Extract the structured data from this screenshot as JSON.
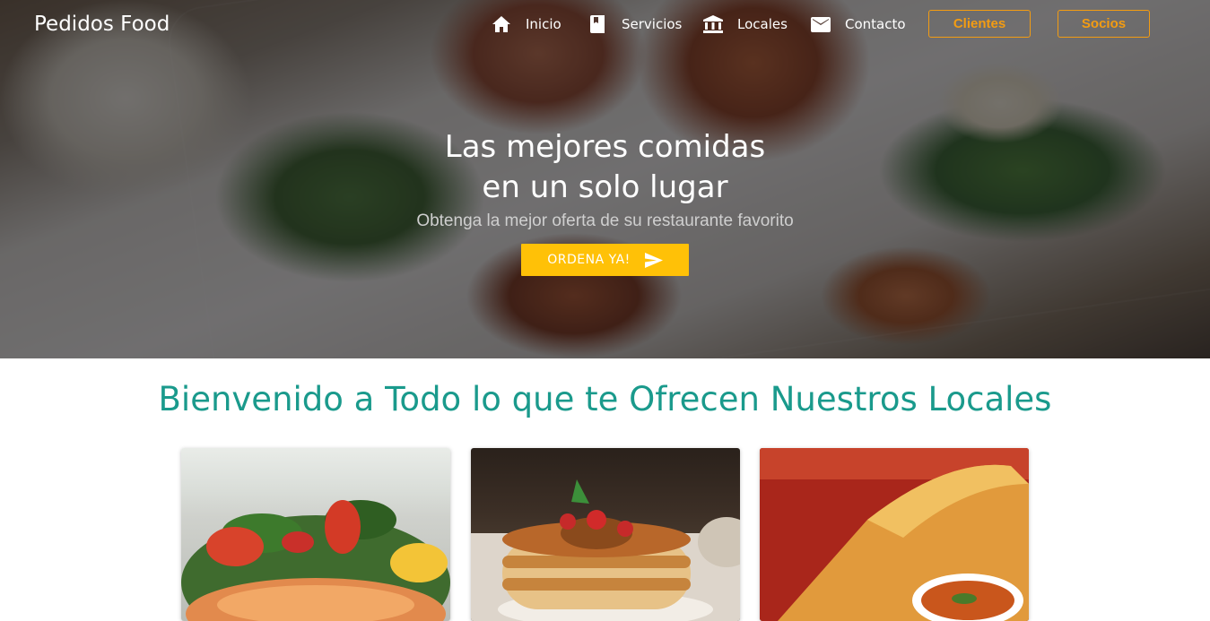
{
  "header": {
    "brand": "Pedidos Food",
    "nav": [
      {
        "label": "Inicio",
        "icon": "home-icon"
      },
      {
        "label": "Servicios",
        "icon": "book-icon"
      },
      {
        "label": "Locales",
        "icon": "bank-icon"
      },
      {
        "label": "Contacto",
        "icon": "mail-icon"
      }
    ],
    "buttons": {
      "clientes": "Clientes",
      "socios": "Socios"
    }
  },
  "hero": {
    "title_line1": "Las mejores comidas",
    "title_line2": "en un solo lugar",
    "subtitle": "Obtenga la mejor oferta de su restaurante favorito",
    "cta_label": "ORDENA YA!",
    "cta_icon": "send-icon"
  },
  "welcome": {
    "heading": "Bienvenido a Todo lo que te Ofrecen Nuestros Locales"
  },
  "cards": [
    {
      "name": "salad-salmon-photo"
    },
    {
      "name": "pancakes-photo"
    },
    {
      "name": "dosa-soup-photo"
    }
  ],
  "colors": {
    "accent_orange": "#f39c12",
    "cta_yellow": "#ffc107",
    "heading_teal": "#1a9a8c"
  }
}
